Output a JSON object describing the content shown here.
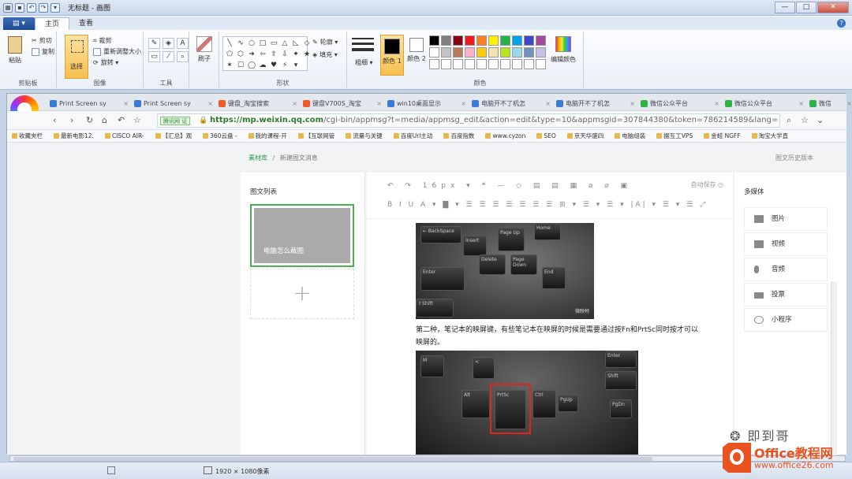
{
  "window": {
    "title": "无标题 - 画图",
    "minimize": "—",
    "maximize": "□",
    "close": "✕"
  },
  "ribbon": {
    "file_label": "▤ ▾",
    "tabs": [
      "主页",
      "查看"
    ],
    "groups": {
      "clipboard": {
        "label": "剪贴板",
        "paste": "粘贴",
        "cut": "剪切",
        "copy": "复制"
      },
      "image": {
        "label": "图像",
        "select": "选择",
        "crop": "裁剪",
        "resize": "重新调整大小",
        "rotate": "旋转 ▾"
      },
      "tools": {
        "label": "工具"
      },
      "brushes": {
        "label": "刷子"
      },
      "shapes": {
        "label": "形状",
        "outline": "轮廓 ▾",
        "fill": "填充 ▾"
      },
      "size": {
        "label": "粗细"
      },
      "colors": {
        "label": "颜色",
        "color1": "颜色 1",
        "color2": "颜色 2",
        "edit": "编辑颜色"
      }
    },
    "palette": [
      "#000000",
      "#7f7f7f",
      "#880015",
      "#ed1c24",
      "#ff7f27",
      "#fff200",
      "#22b14c",
      "#00a2e8",
      "#3f48cc",
      "#a349a4",
      "#ffffff",
      "#c3c3c3",
      "#b97a57",
      "#ffaec9",
      "#ffc90e",
      "#efe4b0",
      "#b5e61d",
      "#99d9ea",
      "#7092be",
      "#c8bfe7",
      "#ffffff",
      "#ffffff",
      "#ffffff",
      "#ffffff",
      "#ffffff",
      "#ffffff",
      "#ffffff",
      "#ffffff",
      "#ffffff",
      "#ffffff"
    ]
  },
  "browser": {
    "tabs": [
      {
        "label": "Print Screen sy",
        "color": "#3b7ad9"
      },
      {
        "label": "Print Screen sy",
        "color": "#3b7ad9"
      },
      {
        "label": "键盘_淘宝搜索",
        "color": "#f05a24"
      },
      {
        "label": "键盘V700S_淘宝",
        "color": "#f05a24"
      },
      {
        "label": "win10桌面显示",
        "color": "#3b7ad9"
      },
      {
        "label": "电脑开不了机怎",
        "color": "#3b7ad9"
      },
      {
        "label": "电脑开不了机怎",
        "color": "#3b7ad9"
      },
      {
        "label": "微信公众平台",
        "color": "#2fb344"
      },
      {
        "label": "微信公众平台",
        "color": "#2fb344"
      },
      {
        "label": "微信",
        "color": "#2fb344"
      }
    ],
    "secure_label": "腾讯网 证",
    "url_host": "https://mp.weixin.qq.com",
    "url_path": "/cgi-bin/appmsg?t=media/appmsg_edit&action=edit&type=10&appmsgid=307844380&token=786214589&lang=",
    "bookmarks": [
      "收藏夹栏",
      "最新电影12.",
      "CISCO AIR-",
      "【汇总】观",
      "360云盘 -",
      "我的课程-开",
      "【互联网管",
      "流量与关键",
      "百度Url主动",
      "百度指数",
      "www.cyzon",
      "SEO",
      "京天华盛四",
      "电脑组装",
      "据互工VPS",
      "金蛙 NGFF",
      "淘宝大学直"
    ]
  },
  "page": {
    "breadcrumb_root": "素材库",
    "breadcrumb_sep": "/",
    "breadcrumb_current": "新建图文消息",
    "history_link": "图文历史版本",
    "article_list_title": "图文列表",
    "article_title": "电脑怎么截图",
    "add_symbol": "+",
    "autosave": "自动保存 ◷",
    "toolbar_row1": "↶ ↷ 16px ▾ ❝ — ◇ ▤ ▤ ▦ ⌀ ⌀ ▣",
    "toolbar_row2": "B I U A ▾ ▇ ▾ ☰ ☰ ☰ ☰ ☰ ☰ ☰ ⊞ ▾ ☰ ▾ ☰ ▾ |A| ▾ ☰ ▾ ☰ ⤢",
    "paragraph": "第二种，笔记本的映屏键，有些笔记本在映屏的时候是需要通过按Fn和PrtSc同时按才可以映屏的。",
    "media_title": "多媒体",
    "media_items": [
      "图片",
      "视频",
      "音频",
      "投票",
      "小程序"
    ],
    "keys1": [
      "← BackSpace",
      "Insert",
      "Page Up",
      "Home",
      "Delete",
      "Page Down",
      "Enter",
      "End",
      "⇧Shift"
    ],
    "keys2": [
      "M",
      "<",
      "PrtSc",
      "Ctrl",
      "PgUp",
      "PgDn",
      "Alt",
      "Shift",
      "Enter"
    ],
    "img_watermark": "微映柯"
  },
  "status": {
    "dimensions": "1920 × 1080像素"
  },
  "watermark": {
    "wechat_label": "❂ 即到哥",
    "brand": "Office教程网",
    "site": "www.office26.com"
  }
}
